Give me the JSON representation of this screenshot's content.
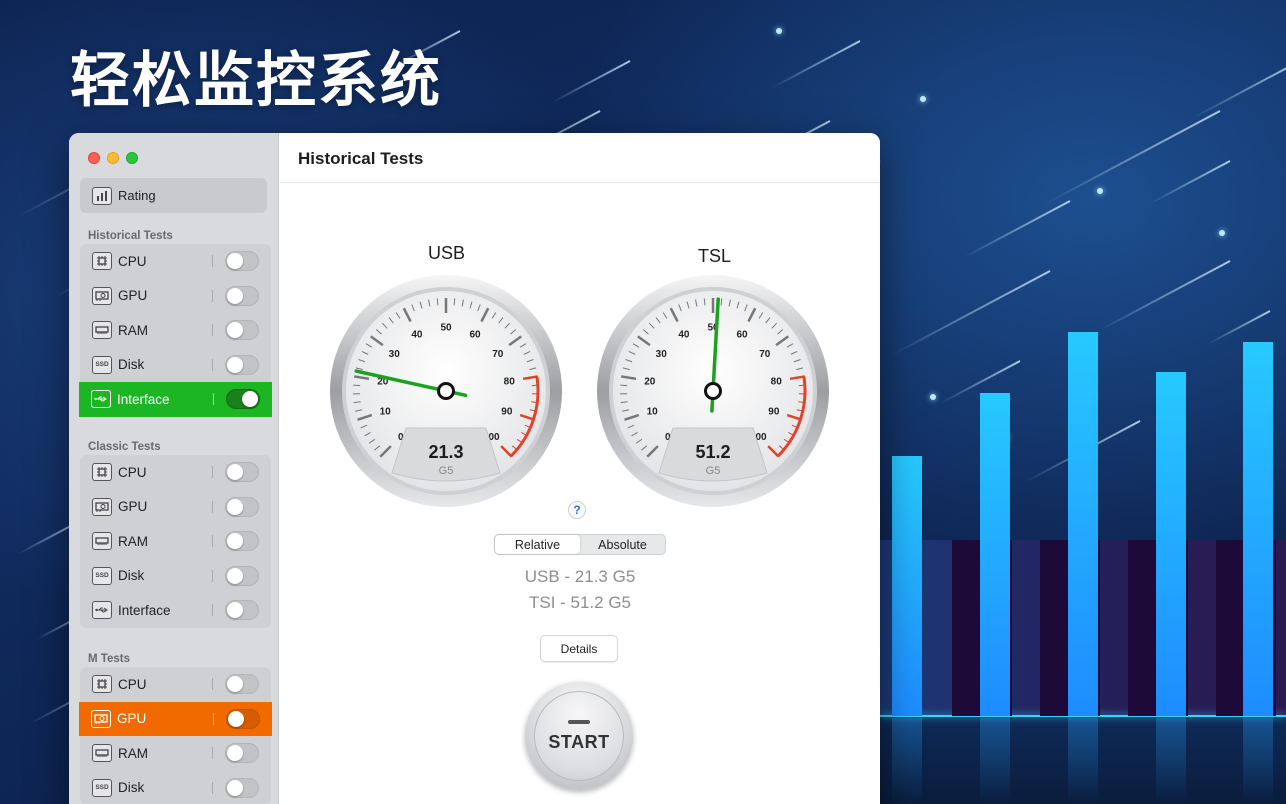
{
  "headline": "轻松监控系统",
  "sidebar": {
    "rating_label": "Rating",
    "sections": [
      {
        "title": "Historical Tests",
        "items": [
          {
            "label": "CPU",
            "icon": "cpu-icon",
            "on": false
          },
          {
            "label": "GPU",
            "icon": "gpu-icon",
            "on": false
          },
          {
            "label": "RAM",
            "icon": "ram-icon",
            "on": false
          },
          {
            "label": "Disk",
            "icon": "ssd-icon",
            "on": false
          },
          {
            "label": "Interface",
            "icon": "usb-icon",
            "on": true
          }
        ]
      },
      {
        "title": "Classic Tests",
        "items": [
          {
            "label": "CPU",
            "icon": "cpu-icon",
            "on": false
          },
          {
            "label": "GPU",
            "icon": "gpu-icon",
            "on": false
          },
          {
            "label": "RAM",
            "icon": "ram-icon",
            "on": false
          },
          {
            "label": "Disk",
            "icon": "ssd-icon",
            "on": false
          },
          {
            "label": "Interface",
            "icon": "usb-icon",
            "on": false
          }
        ]
      },
      {
        "title": "M Tests",
        "items": [
          {
            "label": "CPU",
            "icon": "cpu-icon",
            "on": false
          },
          {
            "label": "GPU",
            "icon": "gpu-icon",
            "on": false
          },
          {
            "label": "RAM",
            "icon": "ram-icon",
            "on": false
          },
          {
            "label": "Disk",
            "icon": "ssd-icon",
            "on": false
          }
        ]
      }
    ]
  },
  "main": {
    "title": "Historical Tests",
    "gauges": [
      {
        "label": "USB",
        "value": "21.3",
        "unit": "G5",
        "reading": 21.3
      },
      {
        "label": "TSL",
        "value": "51.2",
        "unit": "G5",
        "reading": 51.2
      }
    ],
    "gauge_ticks": [
      "0",
      "10",
      "20",
      "30",
      "40",
      "50",
      "60",
      "70",
      "80",
      "90",
      "100"
    ],
    "help": "?",
    "segment": {
      "relative": "Relative",
      "absolute": "Absolute"
    },
    "results": [
      "USB - 21.3 G5",
      "TSI - 51.2 G5"
    ],
    "details_label": "Details",
    "start_label": "START"
  },
  "colors": {
    "accent_green": "#1cb624",
    "accent_orange": "#f06a00",
    "needle": "#19a21f",
    "redline": "#e2412a",
    "bar_cyan": "#27c9ff"
  }
}
